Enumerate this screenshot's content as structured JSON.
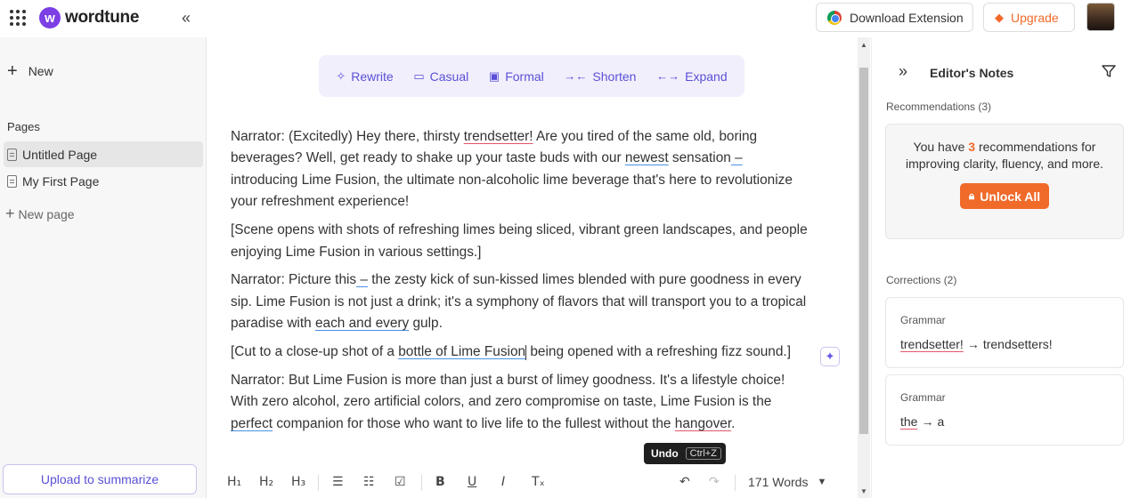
{
  "app": {
    "name": "wordtune",
    "logo_letter": "w"
  },
  "header": {
    "download_extension": "Download Extension",
    "upgrade": "Upgrade"
  },
  "sidebar": {
    "new_label": "New",
    "pages_label": "Pages",
    "pages": [
      {
        "title": "Untitled Page",
        "active": true
      },
      {
        "title": "My First Page",
        "active": false
      }
    ],
    "new_page_label": "New page",
    "upload_label": "Upload to summarize"
  },
  "toolbar": {
    "rewrite": "Rewrite",
    "casual": "Casual",
    "formal": "Formal",
    "shorten": "Shorten",
    "expand": "Expand"
  },
  "editor": {
    "p1": {
      "a": "Narrator: (Excitedly) Hey there, thirsty ",
      "b": "trendsetter!",
      "c": " Are you tired of the same old, boring beverages? Well, get ready to shake up your taste buds with our ",
      "d": "newest",
      "e": " sensation",
      "f": " –",
      "g": " introducing Lime Fusion, the ultimate non-alcoholic lime beverage that's here to revolutionize your refreshment experience!"
    },
    "p2": "[Scene opens with shots of refreshing limes being sliced, vibrant green landscapes, and people enjoying Lime Fusion in various settings.]",
    "p3": {
      "a": "Narrator: Picture this",
      "b": " –",
      "c": " the zesty kick of sun-kissed limes blended with pure goodness in every sip. Lime Fusion is not just a drink; it's a symphony of flavors that will transport you to a tropical paradise with ",
      "d": "each and every",
      "e": " gulp."
    },
    "p4": {
      "a": "[Cut to a close-up shot of a ",
      "b": "bottle of Lime Fusion",
      "c": " being opened with a refreshing fizz sound.]"
    },
    "p5": {
      "a": "Narrator: But Lime Fusion is more than just a burst of limey goodness. It's a lifestyle choice! With zero alcohol, zero artificial colors, and zero compromise on taste, Lime Fusion is the ",
      "b": "perfect",
      "c": " companion for those who want to live life to the fullest without the ",
      "d": "hangover",
      "e": "."
    }
  },
  "tooltip": {
    "label": "Undo",
    "shortcut": "Ctrl+Z"
  },
  "format_bar": {
    "h1": "H₁",
    "h2": "H₂",
    "h3": "H₃",
    "bold": "B",
    "underline": "U",
    "italic": "I",
    "clear": "Tₓ",
    "word_count": "171 Words"
  },
  "notes": {
    "title": "Editor's Notes",
    "recommendations_label": "Recommendations (3)",
    "rec_text_pre": "You have ",
    "rec_count": "3",
    "rec_text_post": " recommendations for improving clarity, fluency, and more.",
    "unlock_label": "Unlock All",
    "corrections_label": "Corrections (2)",
    "corrections": [
      {
        "type": "Grammar",
        "original": "trendsetter!",
        "suggestion": "trendsetters!"
      },
      {
        "type": "Grammar",
        "original": "the",
        "suggestion": "a"
      }
    ]
  },
  "colors": {
    "accent": "#5a50d6",
    "brand": "#7b3fe4",
    "upgrade": "#f06a2a",
    "error_underline": "#e2566b",
    "clarity_underline": "#4a90e2"
  }
}
